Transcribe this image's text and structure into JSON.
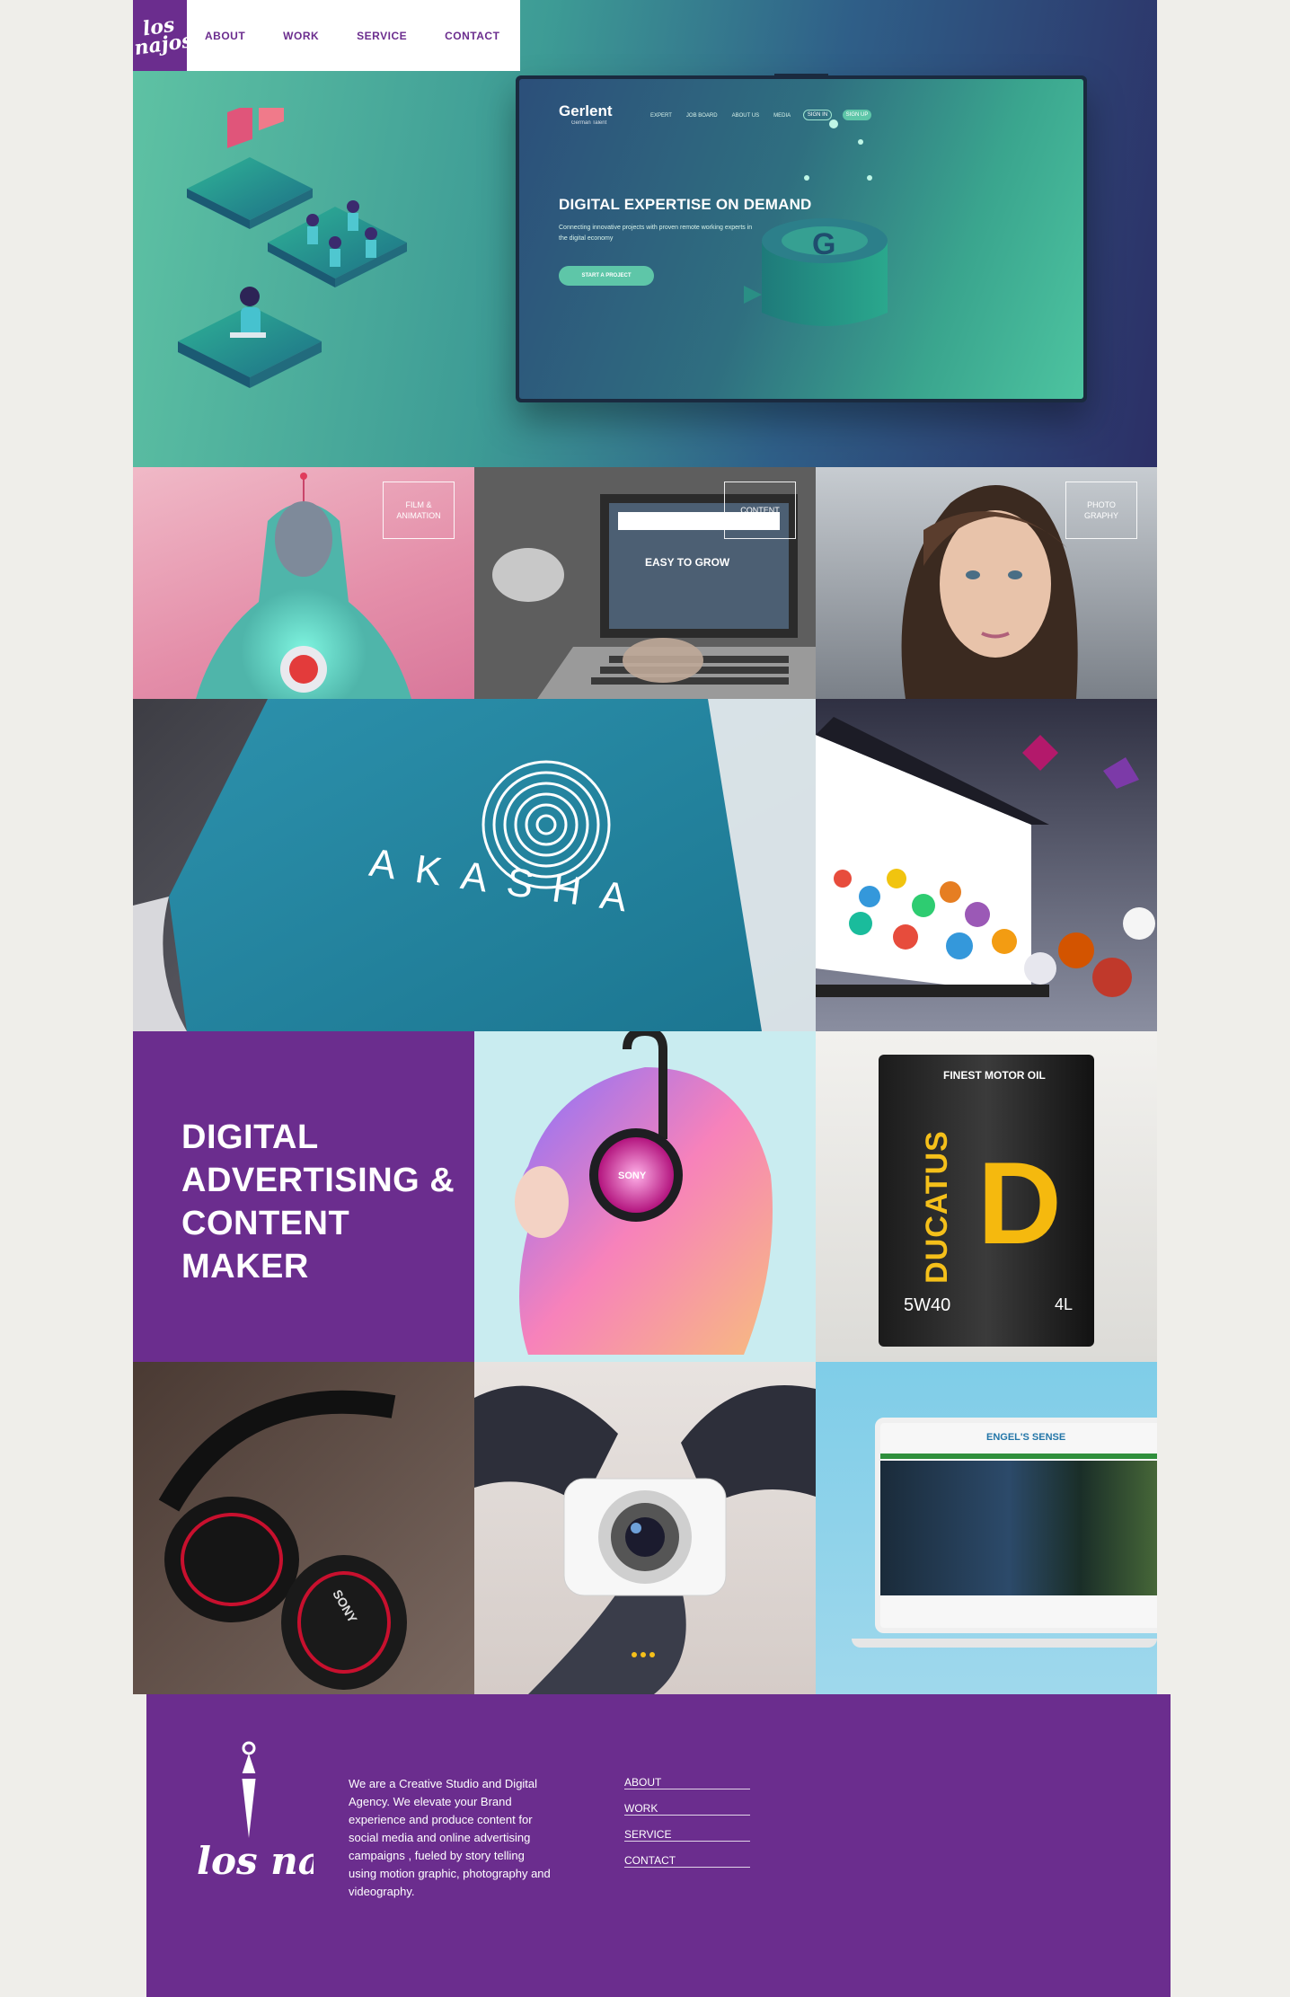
{
  "brand": {
    "logo_text": "los najos",
    "color": "#6b2d8e"
  },
  "nav": {
    "items": [
      "ABOUT",
      "WORK",
      "SERVICE",
      "CONTACT"
    ]
  },
  "hero": {
    "screen": {
      "logo": "Gerlent",
      "logo_sub": "German Talent",
      "menu": [
        "EXPERT",
        "JOB BOARD",
        "ABOUT US",
        "MEDIA"
      ],
      "sign_in": "SIGN IN",
      "sign_up": "SIGN UP",
      "title": "DIGITAL EXPERTISE ON DEMAND",
      "subtitle": "Connecting innovative projects with proven remote working experts in the digital economy",
      "cta": "START A PROJECT",
      "big_letter": "G"
    }
  },
  "tiles": {
    "film_label": "FILM & ANIMATION",
    "content_label": "CONTENT",
    "photo_label": "PHOTO GRAPHY",
    "laptop_screen_text": "EASY TO GROW",
    "akasha": "AKASHA",
    "tagline": "DIGITAL ADVERTISING & CONTENT MAKER",
    "sony": "SONY",
    "oil_top": "FINEST MOTOR OIL",
    "oil_brand": "DUCATUS",
    "oil_grade": "5W40",
    "oil_size": "4L",
    "oil_letter": "D",
    "headphones_brand": "SONY",
    "engels": "ENGEL'S SENSE"
  },
  "footer": {
    "description": "We are a Creative Studio and Digital Agency. We elevate your Brand experience and produce content for social media and online advertising campaigns , fueled by story telling using motion graphic, photography and videography.",
    "links": [
      "ABOUT",
      "WORK",
      "SERVICE",
      "CONTACT"
    ]
  }
}
